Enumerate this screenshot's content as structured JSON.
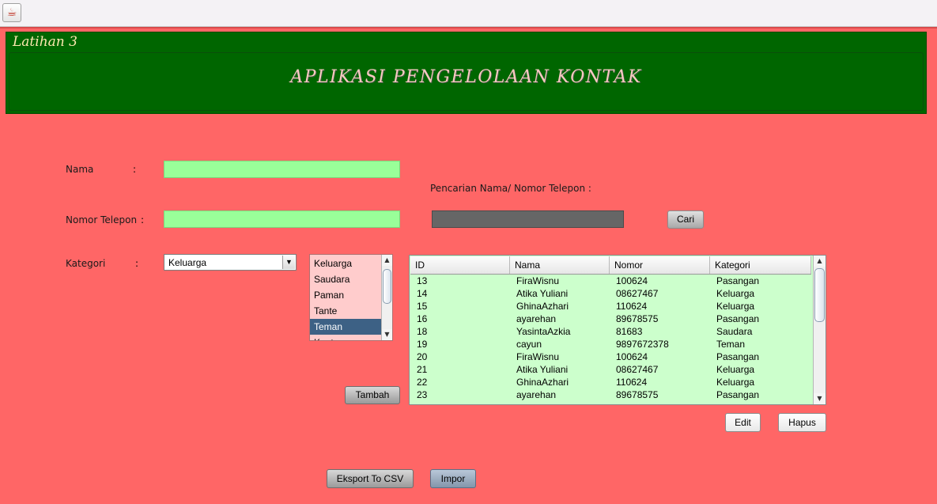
{
  "window": {
    "icon": "java-cup-icon"
  },
  "header": {
    "title": "Latihan 3",
    "app_title": "APLIKASI PENGELOLAAN KONTAK"
  },
  "form": {
    "nama_label": "Nama",
    "nomor_label": "Nomor Telepon",
    "kategori_label": "Kategori",
    "colon": ":",
    "nama_value": "",
    "nomor_value": "",
    "kategori_selected": "Keluarga",
    "search_label": "Pencarian Nama/ Nomor Telepon :",
    "search_value": ""
  },
  "buttons": {
    "cari": "Cari",
    "tambah": "Tambah",
    "edit": "Edit",
    "hapus": "Hapus",
    "eksport": "Eksport To CSV",
    "impor": "Impor"
  },
  "category_list": {
    "items": [
      "Keluarga",
      "Saudara",
      "Paman",
      "Tante",
      "Teman",
      "Kantor"
    ],
    "selected": "Teman"
  },
  "table": {
    "columns": [
      "ID",
      "Nama",
      "Nomor",
      "Kategori"
    ],
    "rows": [
      [
        "13",
        "FiraWisnu",
        "100624",
        "Pasangan"
      ],
      [
        "14",
        "Atika Yuliani",
        "08627467",
        "Keluarga"
      ],
      [
        "15",
        "GhinaAzhari",
        "110624",
        "Keluarga"
      ],
      [
        "16",
        "ayarehan",
        "89678575",
        "Pasangan"
      ],
      [
        "18",
        "YasintaAzkia",
        "81683",
        "Saudara"
      ],
      [
        "19",
        "cayun",
        "9897672378",
        "Teman"
      ],
      [
        "20",
        "FiraWisnu",
        "100624",
        "Pasangan"
      ],
      [
        "21",
        "Atika Yuliani",
        "08627467",
        "Keluarga"
      ],
      [
        "22",
        "GhinaAzhari",
        "110624",
        "Keluarga"
      ],
      [
        "23",
        "ayarehan",
        "89678575",
        "Pasangan"
      ]
    ]
  },
  "colors": {
    "background": "#ff6666",
    "header": "#006600",
    "field": "#99ff99",
    "table": "#ccffcc",
    "list": "#ffcccc",
    "selected": "#3d6185"
  }
}
